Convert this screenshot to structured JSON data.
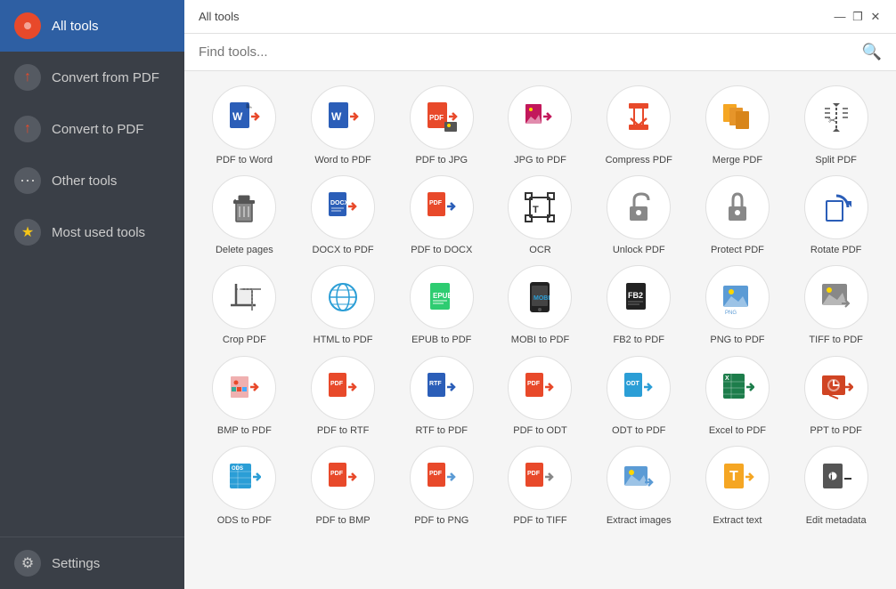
{
  "window": {
    "title": "All tools"
  },
  "sidebar": {
    "items": [
      {
        "id": "all-tools",
        "label": "All tools",
        "active": true,
        "icon": "🔴"
      },
      {
        "id": "convert-from-pdf",
        "label": "Convert from PDF",
        "active": false,
        "icon": "⬆"
      },
      {
        "id": "convert-to-pdf",
        "label": "Convert to PDF",
        "active": false,
        "icon": "⬆"
      },
      {
        "id": "other-tools",
        "label": "Other tools",
        "active": false,
        "icon": "⋯"
      },
      {
        "id": "most-used",
        "label": "Most used tools",
        "active": false,
        "icon": "★"
      }
    ],
    "settings": {
      "label": "Settings",
      "icon": "⚙"
    }
  },
  "search": {
    "placeholder": "Find tools..."
  },
  "tools": [
    {
      "id": "pdf-to-word",
      "label": "PDF to Word",
      "emoji": "📄",
      "color": "#2b5eb8"
    },
    {
      "id": "word-to-pdf",
      "label": "Word to PDF",
      "emoji": "📝",
      "color": "#2b5eb8"
    },
    {
      "id": "pdf-to-jpg",
      "label": "PDF to JPG",
      "emoji": "🖼",
      "color": "#e8492a"
    },
    {
      "id": "jpg-to-pdf",
      "label": "JPG to PDF",
      "emoji": "📷",
      "color": "#c2185b"
    },
    {
      "id": "compress-pdf",
      "label": "Compress PDF",
      "emoji": "⬇",
      "color": "#e8492a"
    },
    {
      "id": "merge-pdf",
      "label": "Merge PDF",
      "emoji": "📋",
      "color": "#f5a623"
    },
    {
      "id": "split-pdf",
      "label": "Split PDF",
      "emoji": "✂",
      "color": "#555"
    },
    {
      "id": "delete-pages",
      "label": "Delete pages",
      "emoji": "🗑",
      "color": "#555"
    },
    {
      "id": "docx-to-pdf",
      "label": "DOCX to PDF",
      "emoji": "📄",
      "color": "#2b5eb8"
    },
    {
      "id": "pdf-to-docx",
      "label": "PDF to DOCX",
      "emoji": "📄",
      "color": "#2b5eb8"
    },
    {
      "id": "ocr",
      "label": "OCR",
      "emoji": "🔡",
      "color": "#333"
    },
    {
      "id": "unlock-pdf",
      "label": "Unlock PDF",
      "emoji": "🔓",
      "color": "#888"
    },
    {
      "id": "protect-pdf",
      "label": "Protect PDF",
      "emoji": "🔒",
      "color": "#888"
    },
    {
      "id": "rotate-pdf",
      "label": "Rotate PDF",
      "emoji": "🔄",
      "color": "#2b5eb8"
    },
    {
      "id": "crop-pdf",
      "label": "Crop PDF",
      "emoji": "✂",
      "color": "#555"
    },
    {
      "id": "html-to-pdf",
      "label": "HTML to PDF",
      "emoji": "🌐",
      "color": "#2b9ed6"
    },
    {
      "id": "epub-to-pdf",
      "label": "EPUB to PDF",
      "emoji": "📗",
      "color": "#2ecc71"
    },
    {
      "id": "mobi-to-pdf",
      "label": "MOBI to PDF",
      "emoji": "📱",
      "color": "#222"
    },
    {
      "id": "fb2-to-pdf",
      "label": "FB2 to PDF",
      "emoji": "📖",
      "color": "#222"
    },
    {
      "id": "png-to-pdf",
      "label": "PNG to PDF",
      "emoji": "🖼",
      "color": "#5b9bd5"
    },
    {
      "id": "tiff-to-pdf",
      "label": "TIFF to PDF",
      "emoji": "📷",
      "color": "#555"
    },
    {
      "id": "bmp-to-pdf",
      "label": "BMP to PDF",
      "emoji": "🖌",
      "color": "#e8492a"
    },
    {
      "id": "pdf-to-rtf",
      "label": "PDF to RTF",
      "emoji": "📄",
      "color": "#e8492a"
    },
    {
      "id": "rtf-to-pdf",
      "label": "RTF to PDF",
      "emoji": "📄",
      "color": "#2b5eb8"
    },
    {
      "id": "pdf-to-odt",
      "label": "PDF to ODT",
      "emoji": "📄",
      "color": "#e8492a"
    },
    {
      "id": "odt-to-pdf",
      "label": "ODT to PDF",
      "emoji": "📄",
      "color": "#2b9ed6"
    },
    {
      "id": "excel-to-pdf",
      "label": "Excel to PDF",
      "emoji": "📊",
      "color": "#1d7d4b"
    },
    {
      "id": "ppt-to-pdf",
      "label": "PPT to PDF",
      "emoji": "📊",
      "color": "#d04423"
    },
    {
      "id": "ods-to-pdf",
      "label": "ODS to PDF",
      "emoji": "📊",
      "color": "#2b9ed6"
    },
    {
      "id": "pdf-to-bmp",
      "label": "PDF to BMP",
      "emoji": "🖼",
      "color": "#e8492a"
    },
    {
      "id": "pdf-to-png",
      "label": "PDF to PNG",
      "emoji": "🖼",
      "color": "#e8492a"
    },
    {
      "id": "pdf-to-tiff",
      "label": "PDF to TIFF",
      "emoji": "🖼",
      "color": "#e8492a"
    },
    {
      "id": "extract-images",
      "label": "Extract images",
      "emoji": "🖼",
      "color": "#5b9bd5"
    },
    {
      "id": "extract-text",
      "label": "Extract text",
      "emoji": "📝",
      "color": "#f5a623"
    },
    {
      "id": "edit-metadata",
      "label": "Edit metadata",
      "emoji": "ℹ",
      "color": "#333"
    }
  ],
  "controls": {
    "minimize": "—",
    "maximize": "❐",
    "close": "✕"
  }
}
